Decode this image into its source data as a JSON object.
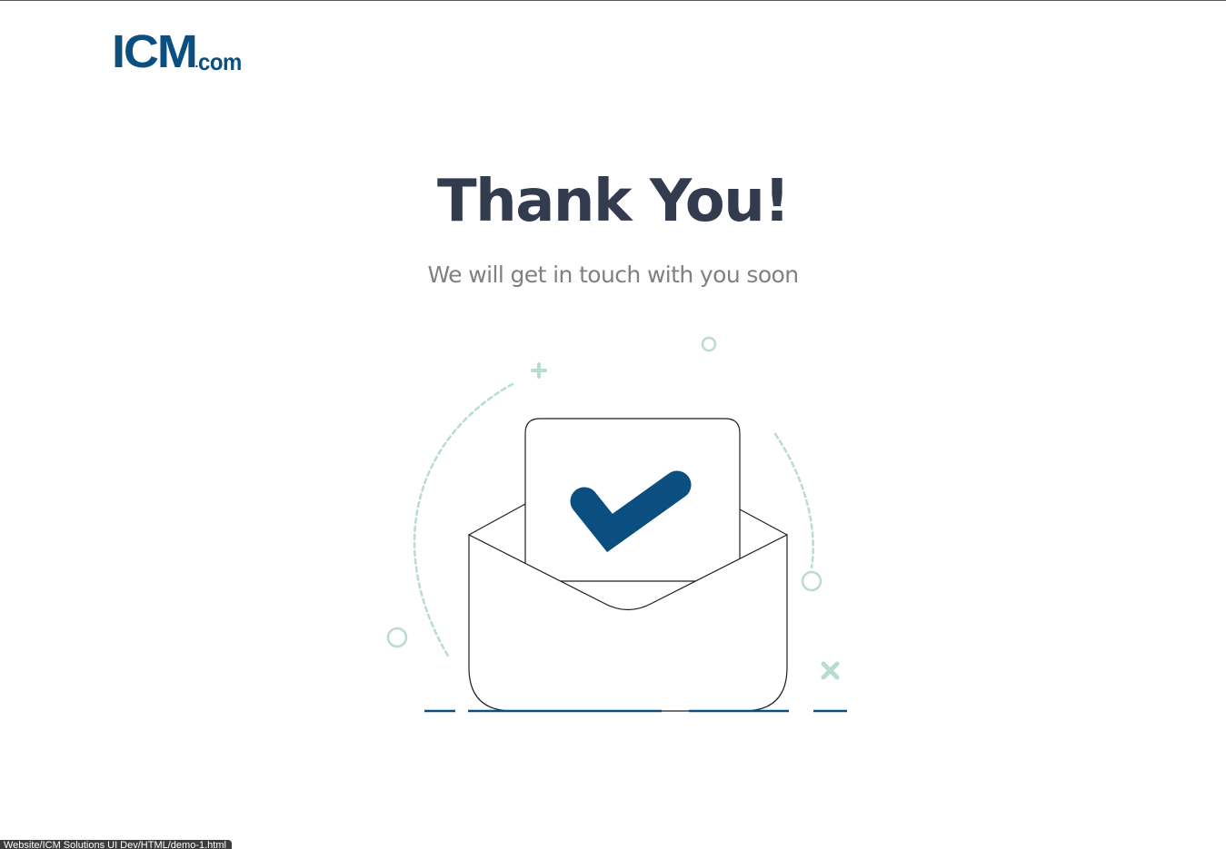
{
  "brand": {
    "logo_main": "ICM",
    "logo_dot": ".",
    "logo_tld": "com"
  },
  "hero": {
    "title": "Thank You!",
    "subtitle": "We will get in touch with you soon"
  },
  "illustration": {
    "icons": [
      "envelope-icon",
      "checkmark-icon",
      "sparkle-plus-icon",
      "sparkle-circle-icon",
      "sparkle-cross-icon"
    ]
  },
  "status_bar": {
    "url_text": "Website/ICM Solutions UI Dev/HTML/demo-1.html"
  },
  "colors": {
    "brand": "#0b4f80",
    "heading": "#333b4e",
    "muted": "#808080",
    "accent_soft": "#b9dcd2",
    "line": "#1e1e1e"
  }
}
